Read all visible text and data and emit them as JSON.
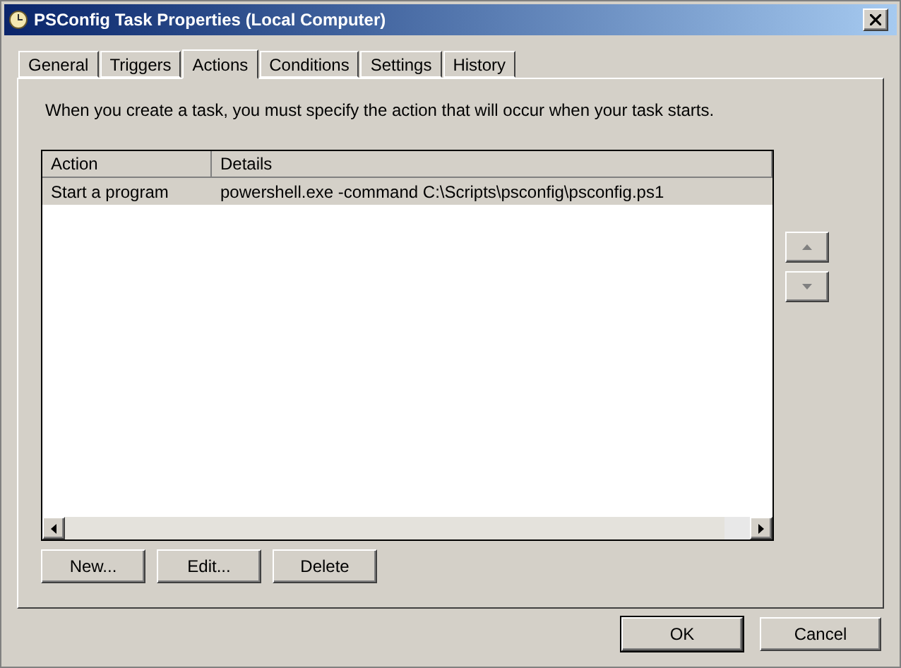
{
  "window": {
    "title": "PSConfig Task Properties (Local Computer)"
  },
  "tabs": [
    {
      "label": "General",
      "selected": false
    },
    {
      "label": "Triggers",
      "selected": false
    },
    {
      "label": "Actions",
      "selected": true
    },
    {
      "label": "Conditions",
      "selected": false
    },
    {
      "label": "Settings",
      "selected": false
    },
    {
      "label": "History",
      "selected": false
    }
  ],
  "description": "When you create a task, you must specify the action that will occur when your task starts.",
  "table": {
    "columns": [
      "Action",
      "Details"
    ],
    "rows": [
      {
        "cells": [
          "Start a program",
          "powershell.exe -command C:\\Scripts\\psconfig\\psconfig.ps1"
        ],
        "selected": true
      }
    ]
  },
  "action_buttons": [
    "New...",
    "Edit...",
    "Delete"
  ],
  "buttons": [
    {
      "label": "OK",
      "default": true
    },
    {
      "label": "Cancel",
      "default": false
    }
  ]
}
